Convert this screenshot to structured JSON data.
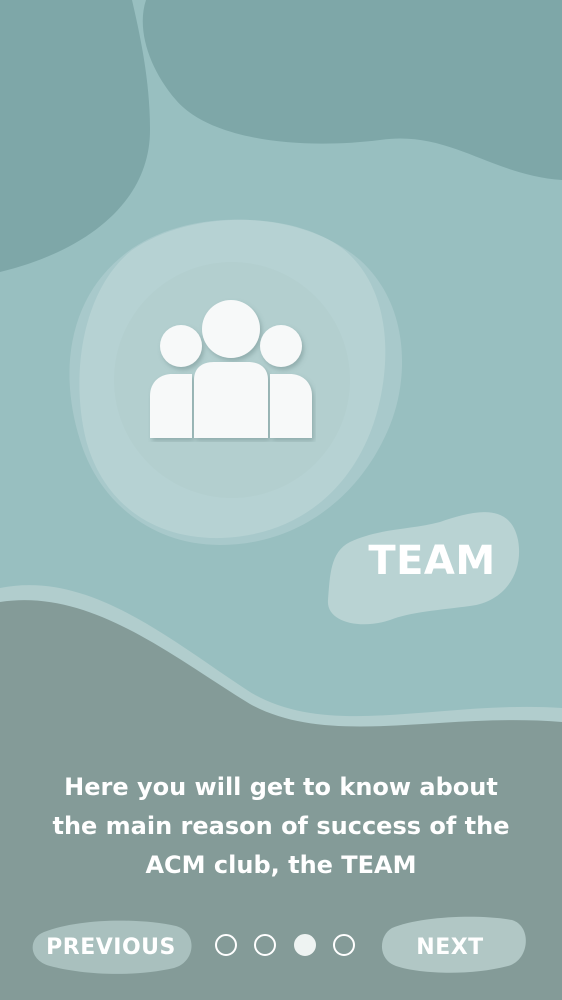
{
  "screen": {
    "title": "TEAM",
    "description": "Here you will get to know about the main reason of success of the ACM club, the TEAM",
    "icon": "team-people-icon"
  },
  "navigation": {
    "previous_label": "PREVIOUS",
    "next_label": "NEXT",
    "page_count": 4,
    "current_page": 3
  },
  "colors": {
    "background": "#98bfc0",
    "dark_blob": "#7da5a6",
    "bottom_panel": "#849b98",
    "wave_band": "#b1cdcd",
    "text": "#ffffff"
  }
}
